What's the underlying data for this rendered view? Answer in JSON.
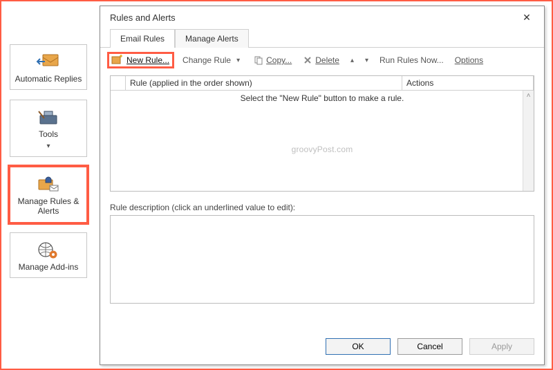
{
  "sidebar": {
    "items": [
      {
        "label": "Automatic Replies"
      },
      {
        "label": "Tools"
      },
      {
        "label": "Manage Rules & Alerts"
      },
      {
        "label": "Manage Add-ins"
      }
    ]
  },
  "dialog": {
    "title": "Rules and Alerts",
    "tabs": [
      {
        "label": "Email Rules"
      },
      {
        "label": "Manage Alerts"
      }
    ],
    "toolbar": {
      "new_rule": "New Rule...",
      "change_rule": "Change Rule",
      "copy": "Copy...",
      "delete": "Delete",
      "run_rules": "Run Rules Now...",
      "options": "Options"
    },
    "columns": {
      "rule": "Rule (applied in the order shown)",
      "actions": "Actions"
    },
    "empty_hint": "Select the \"New Rule\" button to make a rule.",
    "watermark": "groovyPost.com",
    "description_label": "Rule description (click an underlined value to edit):",
    "buttons": {
      "ok": "OK",
      "cancel": "Cancel",
      "apply": "Apply"
    }
  }
}
